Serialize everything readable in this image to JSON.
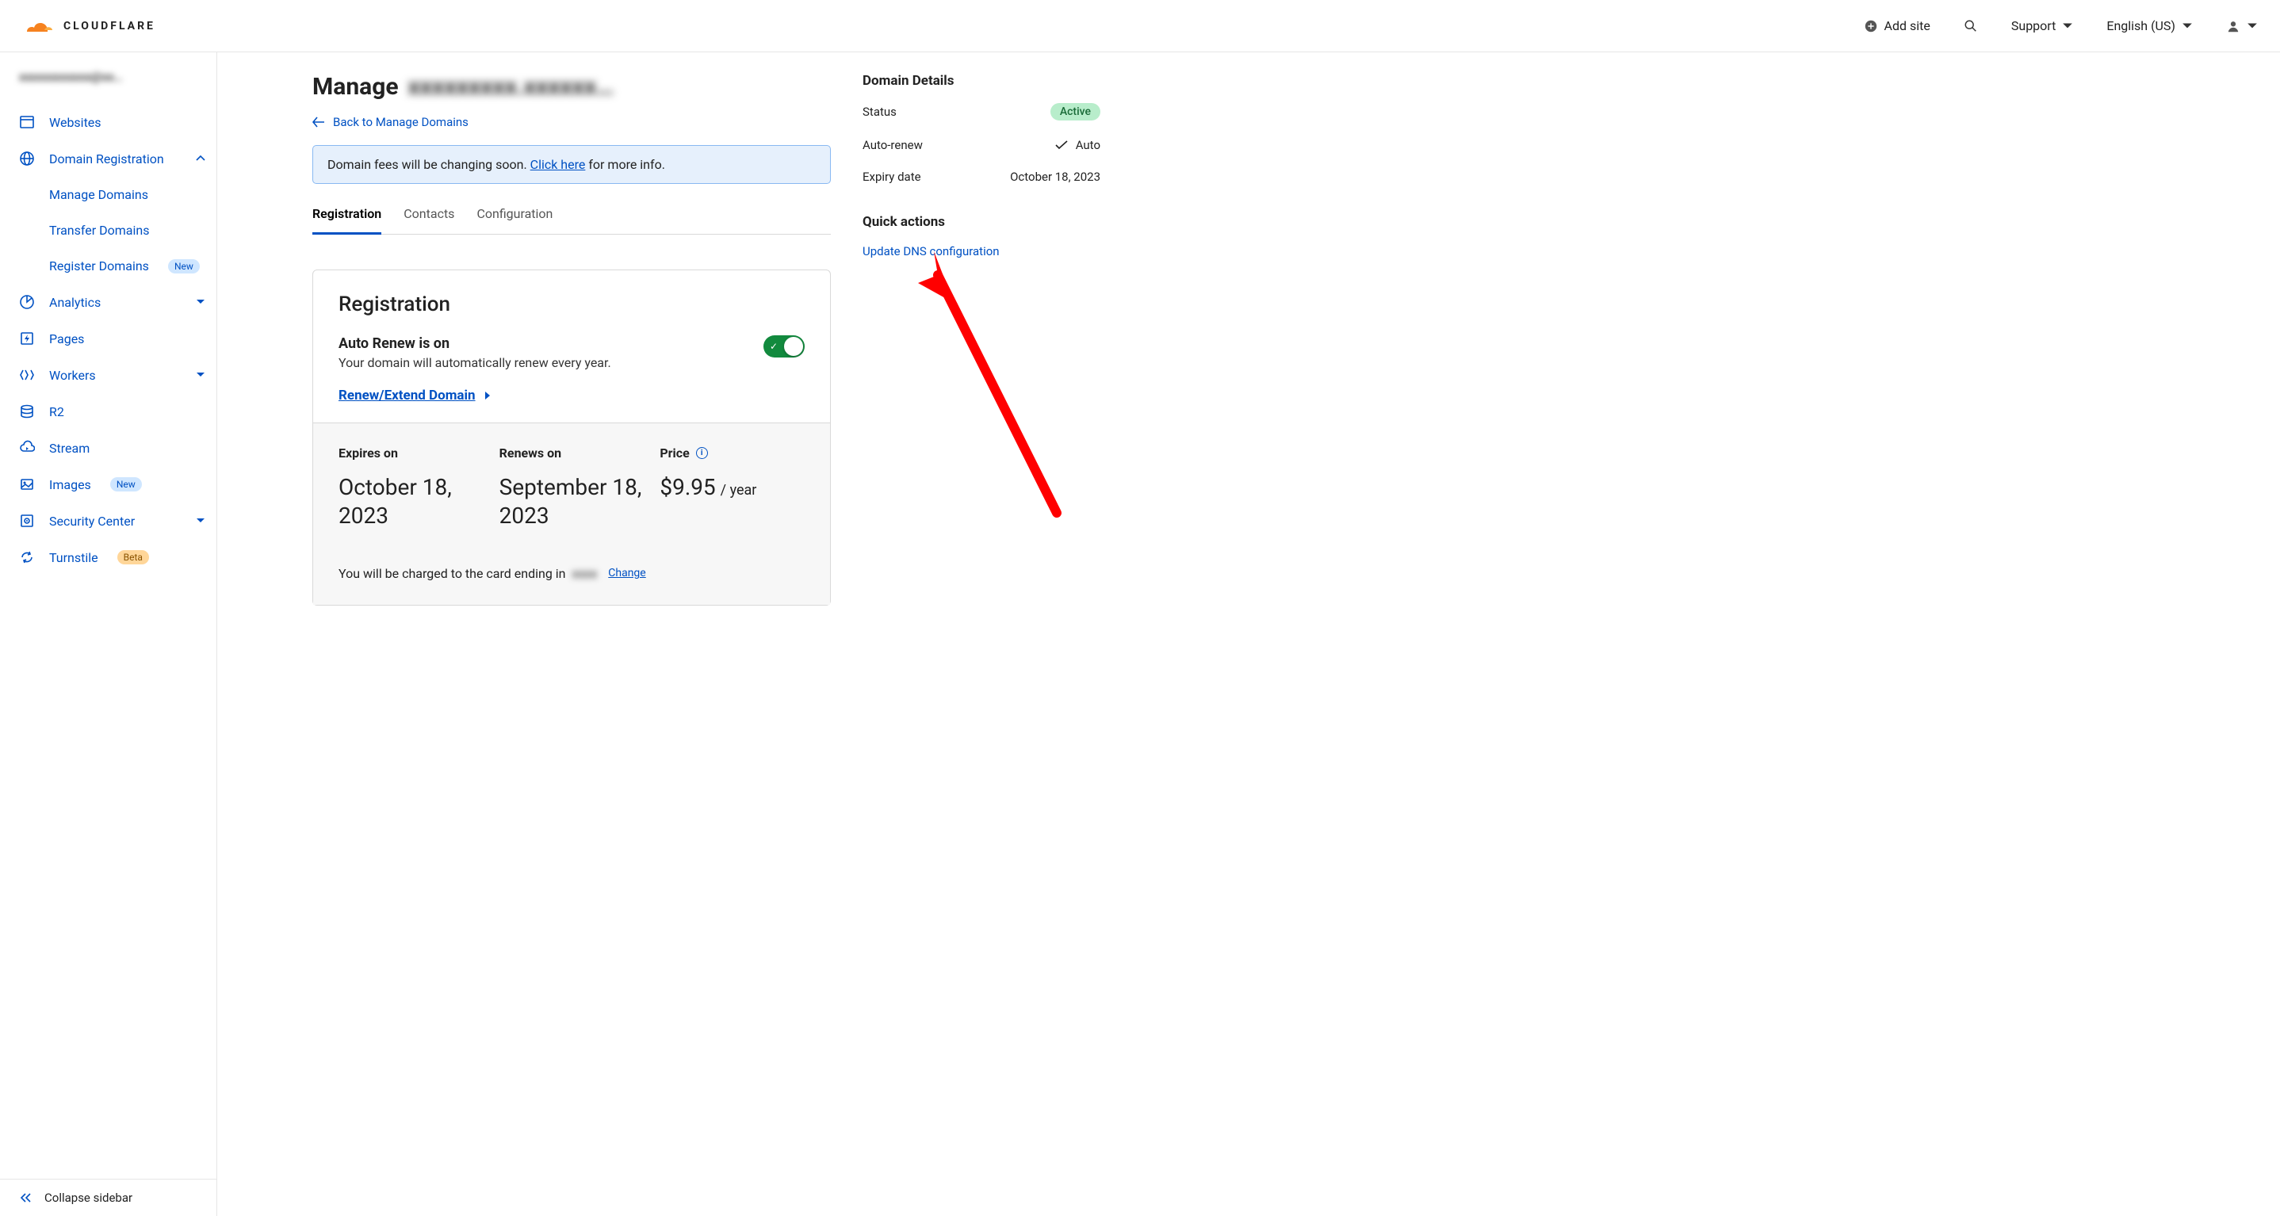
{
  "header": {
    "brand": "CLOUDFLARE",
    "add_site": "Add site",
    "support": "Support",
    "language": "English (US)"
  },
  "sidebar": {
    "account_label_masked": "xxxxxxxxxxxx@xx…",
    "items": {
      "websites": "Websites",
      "domain_registration": "Domain Registration",
      "manage_domains": "Manage Domains",
      "transfer_domains": "Transfer Domains",
      "register_domains": "Register Domains",
      "register_domains_badge": "New",
      "analytics": "Analytics",
      "pages": "Pages",
      "workers": "Workers",
      "r2": "R2",
      "stream": "Stream",
      "images": "Images",
      "images_badge": "New",
      "security_center": "Security Center",
      "turnstile": "Turnstile",
      "turnstile_badge": "Beta"
    },
    "collapse": "Collapse sidebar"
  },
  "page": {
    "title_prefix": "Manage",
    "domain_masked": "xxxxxxxxx.xxxxxx…",
    "back": "Back to Manage Domains",
    "notice_pre": "Domain fees will be changing soon. ",
    "notice_link": "Click here",
    "notice_post": " for more info."
  },
  "tabs": {
    "registration": "Registration",
    "contacts": "Contacts",
    "configuration": "Configuration"
  },
  "card": {
    "heading": "Registration",
    "auto_renew_title": "Auto Renew is on",
    "auto_renew_sub": "Your domain will automatically renew every year.",
    "renew_link": "Renew/Extend Domain",
    "expires_label": "Expires on",
    "expires_value": "October 18, 2023",
    "renews_label": "Renews on",
    "renews_value": "September 18, 2023",
    "price_label": "Price",
    "price_value": "$9.95",
    "price_per": "/ year",
    "charge_pre": "You will be charged to the card ending in ",
    "card_last4_masked": "xxxx",
    "change": "Change"
  },
  "details": {
    "heading": "Domain Details",
    "status_label": "Status",
    "status_value": "Active",
    "autorenew_label": "Auto-renew",
    "autorenew_value": "Auto",
    "expiry_label": "Expiry date",
    "expiry_value": "October 18, 2023",
    "quick_actions_heading": "Quick actions",
    "quick_action_link": "Update DNS configuration"
  }
}
